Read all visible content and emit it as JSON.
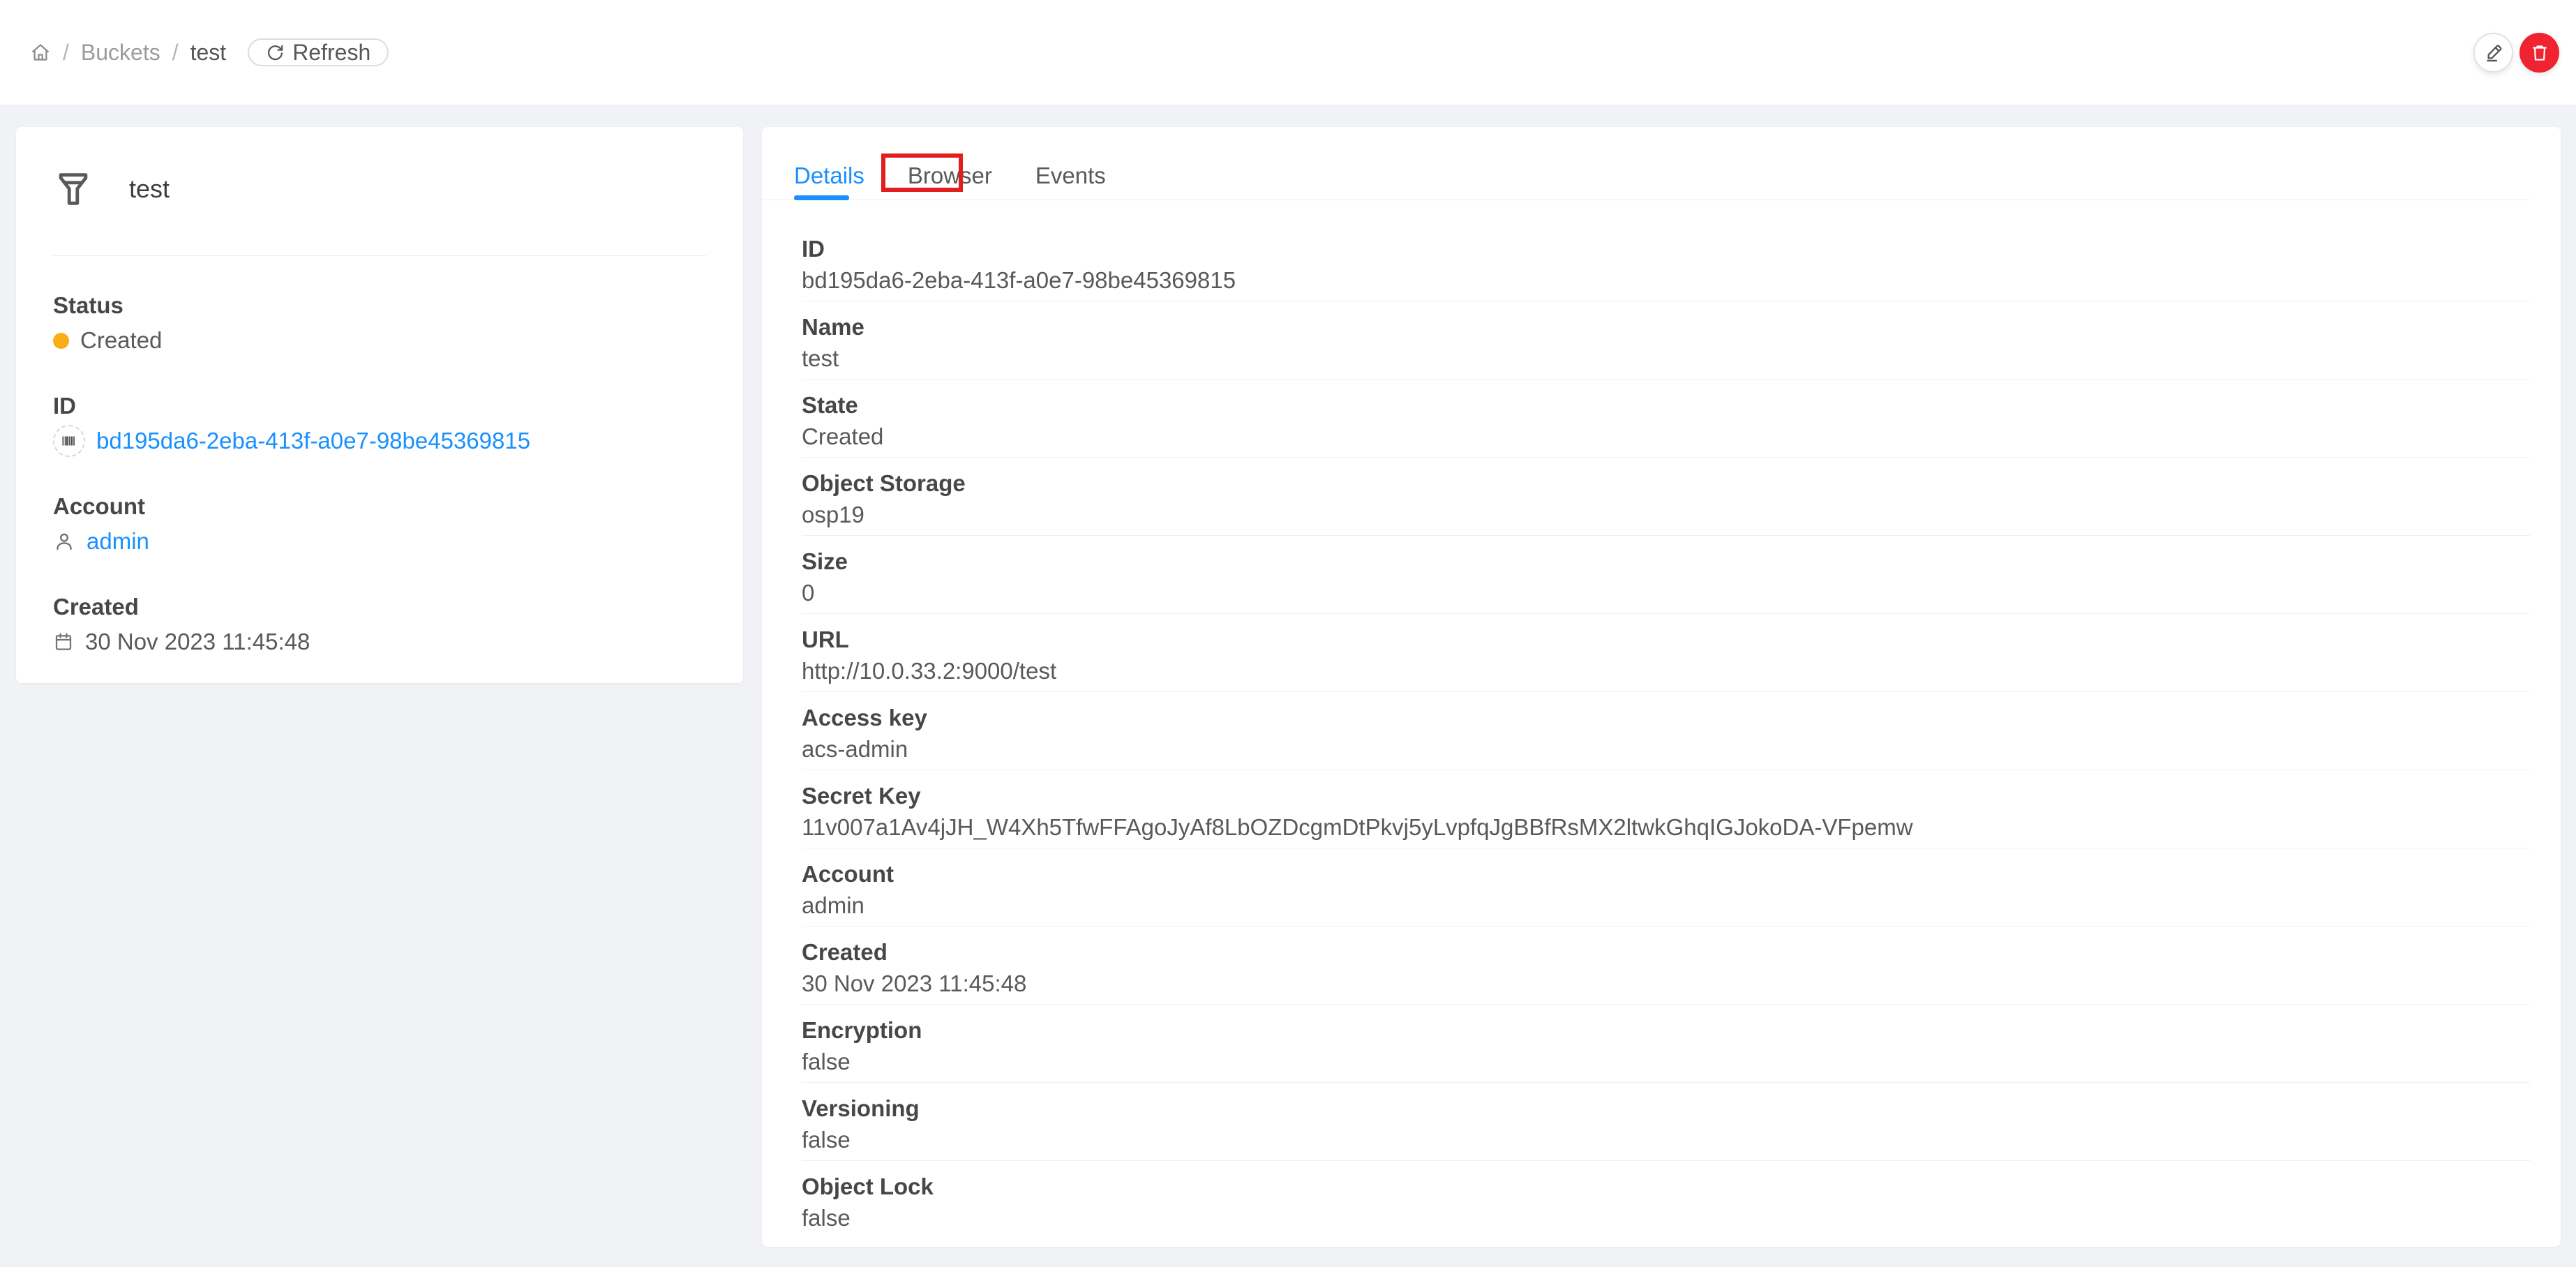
{
  "colors": {
    "accent": "#1890ff",
    "status_dot": "#faad14",
    "danger": "#ef2430",
    "annotation_box": "#e21e1e",
    "background": "#f0f2f5"
  },
  "header": {
    "breadcrumb": {
      "separator": "/",
      "items": [
        {
          "label": "Buckets"
        },
        {
          "label": "test"
        }
      ]
    },
    "refresh_label": "Refresh"
  },
  "info_card": {
    "title": "test",
    "status": {
      "label": "Status",
      "value": "Created"
    },
    "id": {
      "label": "ID",
      "value": "bd195da6-2eba-413f-a0e7-98be45369815"
    },
    "account": {
      "label": "Account",
      "value": "admin"
    },
    "created": {
      "label": "Created",
      "value": "30 Nov 2023 11:45:48"
    }
  },
  "tabs": [
    {
      "label": "Details"
    },
    {
      "label": "Browser"
    },
    {
      "label": "Events"
    }
  ],
  "details": {
    "rows": [
      {
        "label": "ID",
        "value": "bd195da6-2eba-413f-a0e7-98be45369815"
      },
      {
        "label": "Name",
        "value": "test"
      },
      {
        "label": "State",
        "value": "Created"
      },
      {
        "label": "Object Storage",
        "value": "osp19"
      },
      {
        "label": "Size",
        "value": "0"
      },
      {
        "label": "URL",
        "value": "http://10.0.33.2:9000/test"
      },
      {
        "label": "Access key",
        "value": "acs-admin"
      },
      {
        "label": "Secret Key",
        "value": "11v007a1Av4jJH_W4Xh5TfwFFAgoJyAf8LbOZDcgmDtPkvj5yLvpfqJgBBfRsMX2ltwkGhqIGJokoDA-VFpemw"
      },
      {
        "label": "Account",
        "value": "admin"
      },
      {
        "label": "Created",
        "value": "30 Nov 2023 11:45:48"
      },
      {
        "label": "Encryption",
        "value": "false"
      },
      {
        "label": "Versioning",
        "value": "false"
      },
      {
        "label": "Object Lock",
        "value": "false"
      }
    ]
  }
}
